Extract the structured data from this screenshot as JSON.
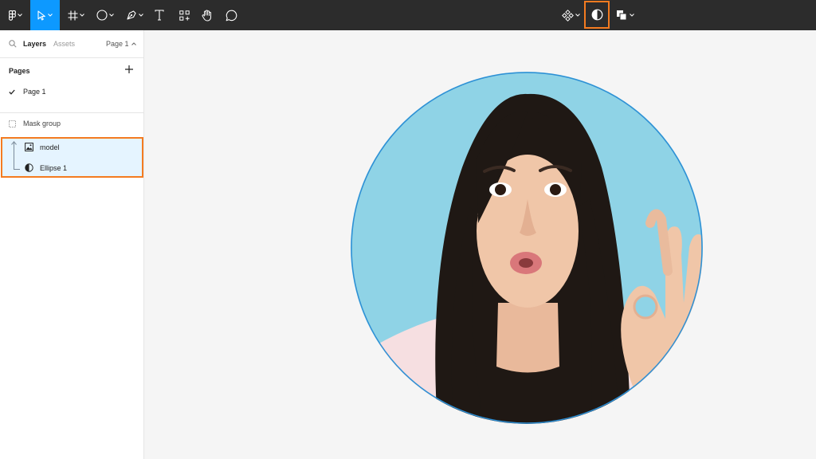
{
  "toolbar": {
    "tools": [
      "main-menu",
      "move",
      "frame",
      "ellipse",
      "pen",
      "text",
      "components",
      "hand",
      "comment"
    ],
    "active_tool": "move",
    "right_tools": [
      "create-component",
      "use-as-mask",
      "boolean-groups"
    ],
    "highlighted_tool": "use-as-mask",
    "highlight_color": "#f47b20",
    "active_color": "#0d99ff"
  },
  "sidebar": {
    "tab_layers": "Layers",
    "tab_assets": "Assets",
    "page_selector": "Page 1",
    "pages_heading": "Pages",
    "current_page": "Page 1",
    "layers": [
      {
        "label": "Mask group",
        "icon": "mask-group-icon"
      },
      {
        "label": "model",
        "icon": "image-icon"
      },
      {
        "label": "Ellipse 1",
        "icon": "mask-icon"
      }
    ],
    "selection_bg": "#e5f4ff"
  },
  "canvas": {
    "background": "#f5f5f5",
    "image_subject": "woman-ok-gesture-photo",
    "mask_shape": "circle",
    "mask_stroke": "#2d8fd5",
    "photo_bg": "#8fd3e6"
  }
}
